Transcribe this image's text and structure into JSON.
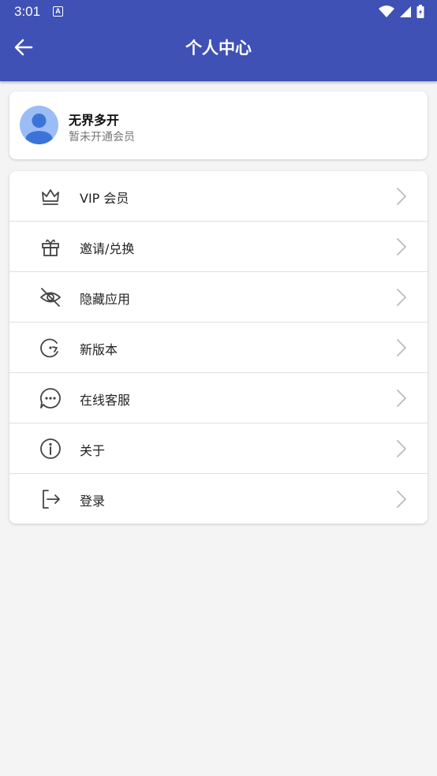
{
  "status_bar": {
    "time": "3:01",
    "notification_badge": "A"
  },
  "app_bar": {
    "title": "个人中心"
  },
  "profile": {
    "name": "无界多开",
    "membership_status": "暂未开通会员"
  },
  "menu": {
    "items": [
      {
        "label": "VIP 会员",
        "icon": "crown-icon"
      },
      {
        "label": "邀请/兑换",
        "icon": "gift-icon"
      },
      {
        "label": "隐藏应用",
        "icon": "eye-off-icon"
      },
      {
        "label": "新版本",
        "icon": "update-icon"
      },
      {
        "label": "在线客服",
        "icon": "chat-icon"
      },
      {
        "label": "关于",
        "icon": "info-icon"
      },
      {
        "label": "登录",
        "icon": "login-icon"
      }
    ]
  },
  "colors": {
    "primary": "#3f51b5",
    "avatar_bg": "#9bbcf5",
    "avatar_fg": "#3b74d9",
    "icon": "#444444"
  }
}
